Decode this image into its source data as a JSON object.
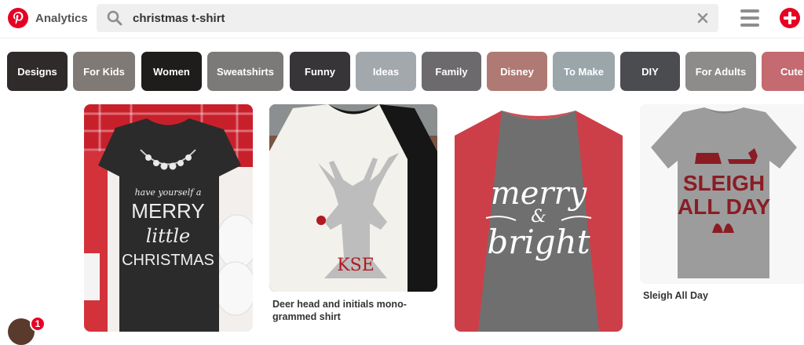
{
  "header": {
    "logo_icon": "pinterest-logo-icon",
    "analytics_label": "Analytics",
    "search": {
      "value": "christmas t-shirt",
      "icon": "search-icon",
      "clear_icon": "close-icon"
    },
    "menu_icon": "hamburger-menu-icon",
    "add_icon": "plus-circle-icon",
    "brand_color": "#e60023"
  },
  "filters": [
    {
      "label": "Designs",
      "color": "#2f2b2a"
    },
    {
      "label": "For Kids",
      "color": "#7f7a76"
    },
    {
      "label": "Women",
      "color": "#1f1c1c"
    },
    {
      "label": "Sweatshirts",
      "color": "#7c7a78"
    },
    {
      "label": "Funny",
      "color": "#373538"
    },
    {
      "label": "Ideas",
      "color": "#a3a8ad"
    },
    {
      "label": "Family",
      "color": "#6c6a6c"
    },
    {
      "label": "Disney",
      "color": "#b07a74"
    },
    {
      "label": "To Make",
      "color": "#9ba6ab"
    },
    {
      "label": "DIY",
      "color": "#4b4c50"
    },
    {
      "label": "For Adults",
      "color": "#8d8c8a"
    },
    {
      "label": "Cute",
      "color": "#c46a70"
    }
  ],
  "pins": [
    {
      "shirt_text": [
        "have yourself a",
        "MERRY",
        "little",
        "CHRISTMAS"
      ],
      "caption": ""
    },
    {
      "shirt_text": [],
      "caption_lines": [
        "Deer head and initials mono-",
        "grammed shirt"
      ]
    },
    {
      "shirt_text": [
        "merry",
        "&",
        "bright"
      ],
      "caption": ""
    },
    {
      "shirt_text": [
        "SLEIGH",
        "ALL DAY"
      ],
      "caption": "Sleigh All Day"
    }
  ],
  "user": {
    "avatar_icon": "user-avatar",
    "notification_count": "1"
  }
}
